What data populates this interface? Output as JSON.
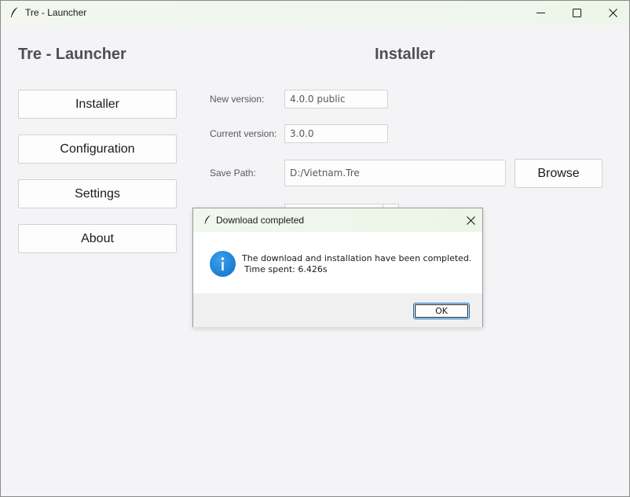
{
  "window": {
    "title": "Tre - Launcher"
  },
  "sidebar": {
    "heading": "Tre - Launcher",
    "items": [
      {
        "label": "Installer"
      },
      {
        "label": "Configuration"
      },
      {
        "label": "Settings"
      },
      {
        "label": "About"
      }
    ]
  },
  "main": {
    "heading": "Installer",
    "new_version_label": "New version:",
    "new_version_value": "4.0.0 public",
    "current_version_label": "Current version:",
    "current_version_value": "3.0.0",
    "save_path_label": "Save Path:",
    "save_path_value": "D:/Vietnam.Tre",
    "browse_label": "Browse"
  },
  "dialog": {
    "title": "Download completed",
    "message_line1": "The download and installation have been completed.",
    "message_line2": "Time spent: 6.426s",
    "ok_label": "OK",
    "icon": "info-icon"
  },
  "colors": {
    "heading": "#4d4f54",
    "titlebar": "#eef6ea",
    "info_icon": "#0b6fc8",
    "ok_border": "#0067c0"
  }
}
